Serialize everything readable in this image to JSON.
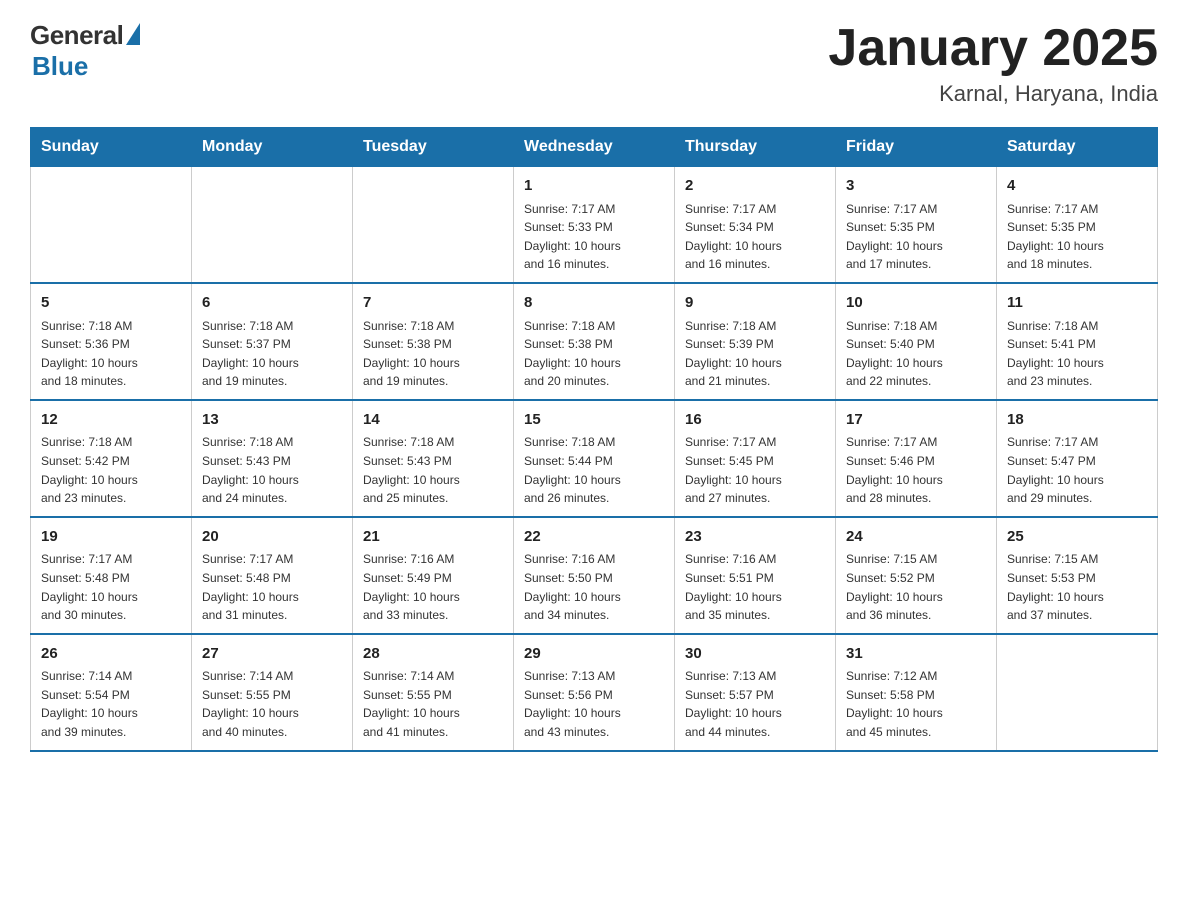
{
  "logo": {
    "general": "General",
    "blue": "Blue",
    "tagline": "Blue"
  },
  "header": {
    "title": "January 2025",
    "subtitle": "Karnal, Haryana, India"
  },
  "days_of_week": [
    "Sunday",
    "Monday",
    "Tuesday",
    "Wednesday",
    "Thursday",
    "Friday",
    "Saturday"
  ],
  "weeks": [
    [
      {
        "day": "",
        "info": ""
      },
      {
        "day": "",
        "info": ""
      },
      {
        "day": "",
        "info": ""
      },
      {
        "day": "1",
        "info": "Sunrise: 7:17 AM\nSunset: 5:33 PM\nDaylight: 10 hours\nand 16 minutes."
      },
      {
        "day": "2",
        "info": "Sunrise: 7:17 AM\nSunset: 5:34 PM\nDaylight: 10 hours\nand 16 minutes."
      },
      {
        "day": "3",
        "info": "Sunrise: 7:17 AM\nSunset: 5:35 PM\nDaylight: 10 hours\nand 17 minutes."
      },
      {
        "day": "4",
        "info": "Sunrise: 7:17 AM\nSunset: 5:35 PM\nDaylight: 10 hours\nand 18 minutes."
      }
    ],
    [
      {
        "day": "5",
        "info": "Sunrise: 7:18 AM\nSunset: 5:36 PM\nDaylight: 10 hours\nand 18 minutes."
      },
      {
        "day": "6",
        "info": "Sunrise: 7:18 AM\nSunset: 5:37 PM\nDaylight: 10 hours\nand 19 minutes."
      },
      {
        "day": "7",
        "info": "Sunrise: 7:18 AM\nSunset: 5:38 PM\nDaylight: 10 hours\nand 19 minutes."
      },
      {
        "day": "8",
        "info": "Sunrise: 7:18 AM\nSunset: 5:38 PM\nDaylight: 10 hours\nand 20 minutes."
      },
      {
        "day": "9",
        "info": "Sunrise: 7:18 AM\nSunset: 5:39 PM\nDaylight: 10 hours\nand 21 minutes."
      },
      {
        "day": "10",
        "info": "Sunrise: 7:18 AM\nSunset: 5:40 PM\nDaylight: 10 hours\nand 22 minutes."
      },
      {
        "day": "11",
        "info": "Sunrise: 7:18 AM\nSunset: 5:41 PM\nDaylight: 10 hours\nand 23 minutes."
      }
    ],
    [
      {
        "day": "12",
        "info": "Sunrise: 7:18 AM\nSunset: 5:42 PM\nDaylight: 10 hours\nand 23 minutes."
      },
      {
        "day": "13",
        "info": "Sunrise: 7:18 AM\nSunset: 5:43 PM\nDaylight: 10 hours\nand 24 minutes."
      },
      {
        "day": "14",
        "info": "Sunrise: 7:18 AM\nSunset: 5:43 PM\nDaylight: 10 hours\nand 25 minutes."
      },
      {
        "day": "15",
        "info": "Sunrise: 7:18 AM\nSunset: 5:44 PM\nDaylight: 10 hours\nand 26 minutes."
      },
      {
        "day": "16",
        "info": "Sunrise: 7:17 AM\nSunset: 5:45 PM\nDaylight: 10 hours\nand 27 minutes."
      },
      {
        "day": "17",
        "info": "Sunrise: 7:17 AM\nSunset: 5:46 PM\nDaylight: 10 hours\nand 28 minutes."
      },
      {
        "day": "18",
        "info": "Sunrise: 7:17 AM\nSunset: 5:47 PM\nDaylight: 10 hours\nand 29 minutes."
      }
    ],
    [
      {
        "day": "19",
        "info": "Sunrise: 7:17 AM\nSunset: 5:48 PM\nDaylight: 10 hours\nand 30 minutes."
      },
      {
        "day": "20",
        "info": "Sunrise: 7:17 AM\nSunset: 5:48 PM\nDaylight: 10 hours\nand 31 minutes."
      },
      {
        "day": "21",
        "info": "Sunrise: 7:16 AM\nSunset: 5:49 PM\nDaylight: 10 hours\nand 33 minutes."
      },
      {
        "day": "22",
        "info": "Sunrise: 7:16 AM\nSunset: 5:50 PM\nDaylight: 10 hours\nand 34 minutes."
      },
      {
        "day": "23",
        "info": "Sunrise: 7:16 AM\nSunset: 5:51 PM\nDaylight: 10 hours\nand 35 minutes."
      },
      {
        "day": "24",
        "info": "Sunrise: 7:15 AM\nSunset: 5:52 PM\nDaylight: 10 hours\nand 36 minutes."
      },
      {
        "day": "25",
        "info": "Sunrise: 7:15 AM\nSunset: 5:53 PM\nDaylight: 10 hours\nand 37 minutes."
      }
    ],
    [
      {
        "day": "26",
        "info": "Sunrise: 7:14 AM\nSunset: 5:54 PM\nDaylight: 10 hours\nand 39 minutes."
      },
      {
        "day": "27",
        "info": "Sunrise: 7:14 AM\nSunset: 5:55 PM\nDaylight: 10 hours\nand 40 minutes."
      },
      {
        "day": "28",
        "info": "Sunrise: 7:14 AM\nSunset: 5:55 PM\nDaylight: 10 hours\nand 41 minutes."
      },
      {
        "day": "29",
        "info": "Sunrise: 7:13 AM\nSunset: 5:56 PM\nDaylight: 10 hours\nand 43 minutes."
      },
      {
        "day": "30",
        "info": "Sunrise: 7:13 AM\nSunset: 5:57 PM\nDaylight: 10 hours\nand 44 minutes."
      },
      {
        "day": "31",
        "info": "Sunrise: 7:12 AM\nSunset: 5:58 PM\nDaylight: 10 hours\nand 45 minutes."
      },
      {
        "day": "",
        "info": ""
      }
    ]
  ]
}
